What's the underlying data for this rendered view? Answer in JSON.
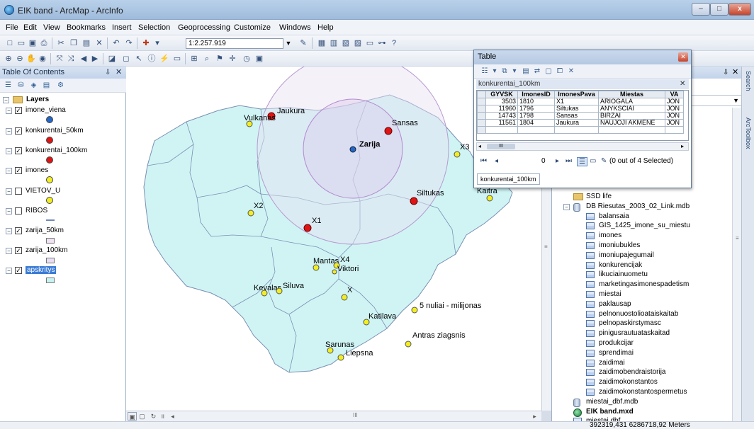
{
  "window": {
    "title": "EIK band - ArcMap - ArcInfo",
    "min": "–",
    "max": "□",
    "close": "x"
  },
  "menu": [
    "File",
    "Edit",
    "View",
    "Bookmarks",
    "Insert",
    "Selection",
    "Geoprocessing",
    "Customize",
    "Windows",
    "Help"
  ],
  "toolbar": {
    "scale": "1:2.257.919"
  },
  "toc": {
    "title": "Table Of Contents",
    "root": "Layers",
    "layers": [
      {
        "name": "imone_viena",
        "checked": "✓",
        "symbol": "dot",
        "color": "#2467c8"
      },
      {
        "name": "konkurentai_50km",
        "checked": "✓",
        "symbol": "dot",
        "color": "#e01414"
      },
      {
        "name": "konkurentai_100km",
        "checked": "✓",
        "symbol": "dot",
        "color": "#e01414"
      },
      {
        "name": "imones",
        "checked": "✓",
        "symbol": "dot",
        "color": "#f2ee22"
      },
      {
        "name": "VIETOV_U",
        "checked": "",
        "symbol": "dot",
        "color": "#f2ee22"
      },
      {
        "name": "RIBOS",
        "checked": "",
        "symbol": "line",
        "color": "#6e89b7"
      },
      {
        "name": "zarija_50km",
        "checked": "✓",
        "symbol": "rect",
        "color": "#efe3f3"
      },
      {
        "name": "zarija_100km",
        "checked": "✓",
        "symbol": "rect",
        "color": "#e9def3"
      },
      {
        "name": "apskritys",
        "checked": "✓",
        "symbol": "rect",
        "color": "#c9f3f3",
        "selected": true
      }
    ]
  },
  "map": {
    "fill": "#d0f4f4",
    "buffer_color": "#e8dff2",
    "points": [
      {
        "label": "Jaukura",
        "type": "red"
      },
      {
        "label": "Vulkanas",
        "type": "yellow"
      },
      {
        "label": "Zarija",
        "type": "blue"
      },
      {
        "label": "Sansas",
        "type": "red"
      },
      {
        "label": "X3",
        "type": "yellow"
      },
      {
        "label": "Siltukas",
        "type": "red"
      },
      {
        "label": "Kaitra",
        "type": "yellow"
      },
      {
        "label": "X2",
        "type": "yellow"
      },
      {
        "label": "X1",
        "type": "red"
      },
      {
        "label": "Mantas",
        "type": "yellow"
      },
      {
        "label": "X4",
        "type": "yellow"
      },
      {
        "label": "Viktori",
        "type": "yellow"
      },
      {
        "label": "Kevalas",
        "type": "yellow"
      },
      {
        "label": "Siluva",
        "type": "yellow"
      },
      {
        "label": "X",
        "type": "yellow"
      },
      {
        "label": "5 nuliai - milijonas",
        "type": "yellow"
      },
      {
        "label": "Katilava",
        "type": "yellow"
      },
      {
        "label": "Antras ziagsnis",
        "type": "yellow"
      },
      {
        "label": "Sarunas",
        "type": "yellow"
      },
      {
        "label": "Liepsna",
        "type": "yellow"
      }
    ]
  },
  "table_window": {
    "title": "Table",
    "table_name": "konkurentai_100km",
    "columns": [
      "GYVSK",
      "ImonesID",
      "ImonesPava",
      "Miestas",
      "VA"
    ],
    "rows": [
      [
        "3503",
        "1810",
        "X1",
        "ARIOGALA",
        "JON"
      ],
      [
        "11960",
        "1796",
        "Siltukas",
        "ANYKŠČIAI",
        "JON"
      ],
      [
        "14743",
        "1798",
        "Sansas",
        "BIRŽAI",
        "JON"
      ],
      [
        "11561",
        "1804",
        "Jaukura",
        "NAUJOJI AKMENĖ",
        "JON"
      ]
    ],
    "nav_number": "0",
    "selection": "(0 out of 4 Selected)",
    "tab": "konkurentai_100km",
    "scroll_label": "III"
  },
  "catalog": {
    "items": [
      {
        "label": "SSD life",
        "icon": "folder",
        "indent": 1
      },
      {
        "label": "DB Riesutas_2003_02_Link.mdb",
        "icon": "db",
        "indent": 1,
        "expander": "⊟"
      },
      {
        "label": "balansaia",
        "icon": "table",
        "indent": 2
      },
      {
        "label": "GIS_1425_imone_su_miestu",
        "icon": "table",
        "indent": 2
      },
      {
        "label": "imones",
        "icon": "table",
        "indent": 2
      },
      {
        "label": "imoniubukles",
        "icon": "table",
        "indent": 2
      },
      {
        "label": "imoniupajegumail",
        "icon": "table",
        "indent": 2
      },
      {
        "label": "konkurencijak",
        "icon": "table",
        "indent": 2
      },
      {
        "label": "likuciainuometu",
        "icon": "table",
        "indent": 2
      },
      {
        "label": "marketingasimonespadetism",
        "icon": "table",
        "indent": 2
      },
      {
        "label": "miestai",
        "icon": "table",
        "indent": 2
      },
      {
        "label": "paklausap",
        "icon": "table",
        "indent": 2
      },
      {
        "label": "pelnonuostolioataiskaitab",
        "icon": "table",
        "indent": 2
      },
      {
        "label": "pelnopaskirstymasc",
        "icon": "table",
        "indent": 2
      },
      {
        "label": "pinigusrautuataskaitad",
        "icon": "table",
        "indent": 2
      },
      {
        "label": "produkcijar",
        "icon": "table",
        "indent": 2
      },
      {
        "label": "sprendimai",
        "icon": "table",
        "indent": 2
      },
      {
        "label": "zaidimai",
        "icon": "table",
        "indent": 2
      },
      {
        "label": "zaidimobendraistorija",
        "icon": "table",
        "indent": 2
      },
      {
        "label": "zaidimokonstantos",
        "icon": "table",
        "indent": 2
      },
      {
        "label": "zaidimokonstantospermetus",
        "icon": "table",
        "indent": 2
      },
      {
        "label": "miestai_dbf.mdb",
        "icon": "db",
        "indent": 1
      },
      {
        "label": "EIK band.mxd",
        "icon": "mxd",
        "indent": 1,
        "bold": true
      },
      {
        "label": "miestai.dbf",
        "icon": "table",
        "indent": 1
      }
    ]
  },
  "side_tabs": [
    "Search",
    "ArcToolbox"
  ],
  "status": {
    "coords": "392319,431  6286718,92 Meters"
  },
  "scrollbar": {
    "thumb": "III"
  }
}
